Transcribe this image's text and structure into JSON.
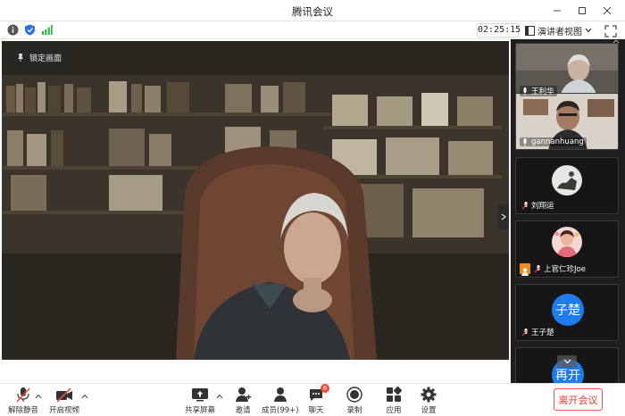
{
  "window": {
    "title": "腾讯会议"
  },
  "infobar": {
    "timer": "02:25:15",
    "view_mode": "演讲者视图"
  },
  "stage": {
    "lock_label": "锁定画面"
  },
  "participants": [
    {
      "name": "王利华",
      "type": "video"
    },
    {
      "name": "gannanhuang",
      "type": "video"
    },
    {
      "name": "刘翔运",
      "type": "avatar"
    },
    {
      "name": "上官仁珍Joe",
      "type": "avatar"
    },
    {
      "name": "王子楚",
      "type": "initials",
      "initials": "子楚"
    },
    {
      "name": "",
      "type": "initials",
      "initials": "再开"
    }
  ],
  "toolbar": {
    "mute_label": "解除静音",
    "video_label": "开启视频",
    "share_label": "共享屏幕",
    "invite_label": "邀请",
    "members_label": "成员(99+)",
    "chat_label": "聊天",
    "chat_badge": "8",
    "record_label": "录制",
    "apps_label": "应用",
    "settings_label": "设置",
    "leave_label": "离开会议"
  },
  "colors": {
    "accent": "#1e7bf0",
    "danger": "#e33b30",
    "panel_bg": "#1e1e1e"
  }
}
